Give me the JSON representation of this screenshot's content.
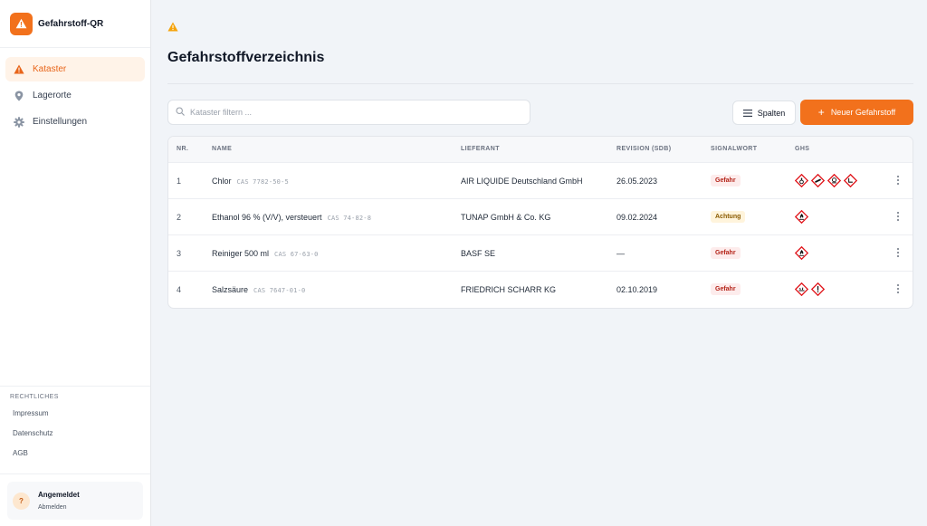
{
  "app": {
    "name": "Gefahrstoff-QR"
  },
  "sidebar": {
    "items": [
      {
        "label": "Kataster",
        "icon": "warning-icon",
        "active": true
      },
      {
        "label": "Lagerorte",
        "icon": "map-pin-icon",
        "active": false
      },
      {
        "label": "Einstellungen",
        "icon": "gear-icon",
        "active": false
      }
    ],
    "legal_heading": "RECHTLICHES",
    "legal_links": [
      "Impressum",
      "Datenschutz",
      "AGB"
    ],
    "user": {
      "avatar": "?",
      "status": "Angemeldet",
      "logout": "Abmelden"
    }
  },
  "main": {
    "title": "Gefahrstoffverzeichnis",
    "search_placeholder": "Kataster filtern ...",
    "columns_button": "Spalten",
    "new_button": "Neuer Gefahrstoff",
    "table": {
      "headers": {
        "nr": "NR.",
        "name": "NAME",
        "supplier": "LIEFERANT",
        "revision": "REVISION (SDB)",
        "signal": "SIGNALWORT",
        "ghs": "GHS"
      },
      "rows": [
        {
          "nr": "1",
          "name": "Chlor",
          "cas": "CAS 7782-50-5",
          "supplier": "AIR LIQUIDE Deutschland GmbH",
          "revision": "26.05.2023",
          "signal": "Gefahr",
          "signal_type": "danger",
          "ghs": [
            "ghs03-oxidizing-icon",
            "ghs04-gas-cylinder-icon",
            "ghs06-skull-icon",
            "ghs05-corrosive-icon"
          ]
        },
        {
          "nr": "2",
          "name": "Ethanol 96 % (V/V), versteuert",
          "cas": "CAS 74-82-8",
          "supplier": "TUNAP GmbH & Co. KG",
          "revision": "09.02.2024",
          "signal": "Achtung",
          "signal_type": "warning",
          "ghs": [
            "ghs02-flame-icon"
          ]
        },
        {
          "nr": "3",
          "name": "Reiniger 500 ml",
          "cas": "CAS 67-63-0",
          "supplier": "BASF SE",
          "revision": "—",
          "signal": "Gefahr",
          "signal_type": "danger",
          "ghs": [
            "ghs02-flame-icon"
          ]
        },
        {
          "nr": "4",
          "name": "Salzsäure",
          "cas": "CAS 7647-01-0",
          "supplier": "FRIEDRICH SCHARR KG",
          "revision": "02.10.2019",
          "signal": "Gefahr",
          "signal_type": "danger",
          "ghs": [
            "ghs05-corrosive-icon",
            "ghs07-exclamation-icon"
          ]
        }
      ]
    }
  },
  "colors": {
    "accent": "#f2711c",
    "ghs_red": "#e0141a",
    "danger_text": "#b42318",
    "warning_text": "#8a5a00"
  }
}
